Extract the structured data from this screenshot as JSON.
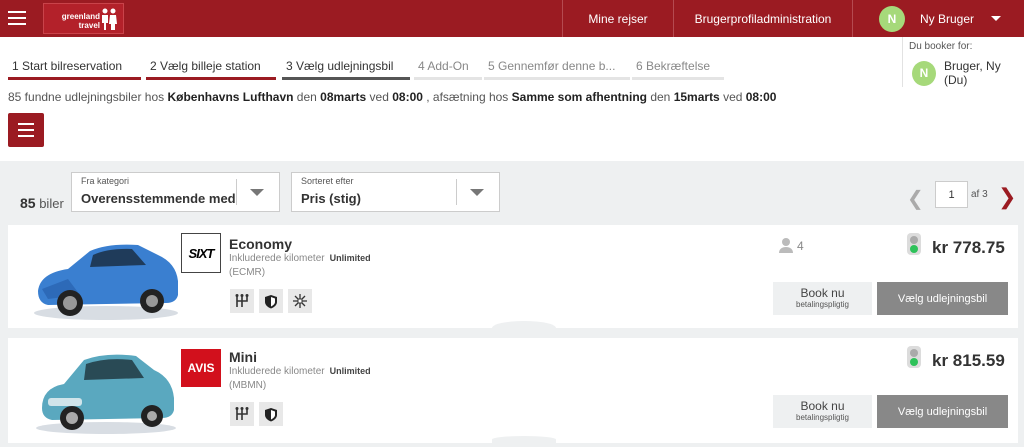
{
  "header": {
    "logo_text": "greenland\ntravel",
    "nav_trips": "Mine rejser",
    "nav_profile": "Brugerprofiladministration",
    "user_initial": "N",
    "user_name": "Ny Bruger"
  },
  "steps": [
    {
      "label": "1  Start bilreservation",
      "state": "done"
    },
    {
      "label": "2  Vælg billeje station",
      "state": "done"
    },
    {
      "label": "3  Vælg udlejningsbil",
      "state": "active"
    },
    {
      "label": "4  Add-On",
      "state": "todo"
    },
    {
      "label": "5  Gennemfør denne b...",
      "state": "todo"
    },
    {
      "label": "6  Bekræftelse",
      "state": "todo"
    }
  ],
  "booking_for": {
    "label": "Du booker for:",
    "initial": "N",
    "name": "Bruger, Ny (Du)"
  },
  "summary": {
    "t1": "85 fundne udlejningsbiler hos ",
    "pickup": "Københavns Lufthavn",
    "t2": " den ",
    "pickup_date": "08marts",
    "t3": " ved ",
    "pickup_time": "08:00",
    "t4": " , afsætning hos ",
    "dropoff": "Samme som afhentning",
    "t5": " den ",
    "dropoff_date": "15marts",
    "t6": " ved ",
    "dropoff_time": "08:00"
  },
  "toolbar": {
    "count": "85",
    "count_unit": "biler",
    "category_label": "Fra kategori",
    "category_value": "Overensstemmende med pr",
    "sort_label": "Sorteret efter",
    "sort_value": "Pris (stig)",
    "page": "1",
    "page_total": "af 3"
  },
  "cars": [
    {
      "brand": "SIXT",
      "name": "Economy",
      "km_label": "Inkluderede kilometer",
      "km_value": "Unlimited",
      "code": "(ECMR)",
      "seats": "4",
      "price": "kr 778.75",
      "book_later": "Book nu",
      "book_later_sub": "betalingspligtig",
      "choose": "Vælg udlejningsbil",
      "body_color": "#3a7fd0"
    },
    {
      "brand": "AVIS",
      "name": "Mini",
      "km_label": "Inkluderede kilometer",
      "km_value": "Unlimited",
      "code": "(MBMN)",
      "seats": "",
      "price": "kr 815.59",
      "book_later": "Book nu",
      "book_later_sub": "betalingspligtig",
      "choose": "Vælg udlejningsbil",
      "body_color": "#5aa8bf"
    }
  ],
  "colors": {
    "brand": "#9b1b22",
    "accent_green": "#a6d97a",
    "button_grey": "#888888"
  },
  "icons": [
    "menu-icon",
    "filter-icon",
    "chevron-down-icon",
    "chevron-left-icon",
    "chevron-right-icon",
    "person-icon",
    "traffic-light-icon",
    "gearshift-icon",
    "shield-icon",
    "air-conditioning-icon"
  ]
}
